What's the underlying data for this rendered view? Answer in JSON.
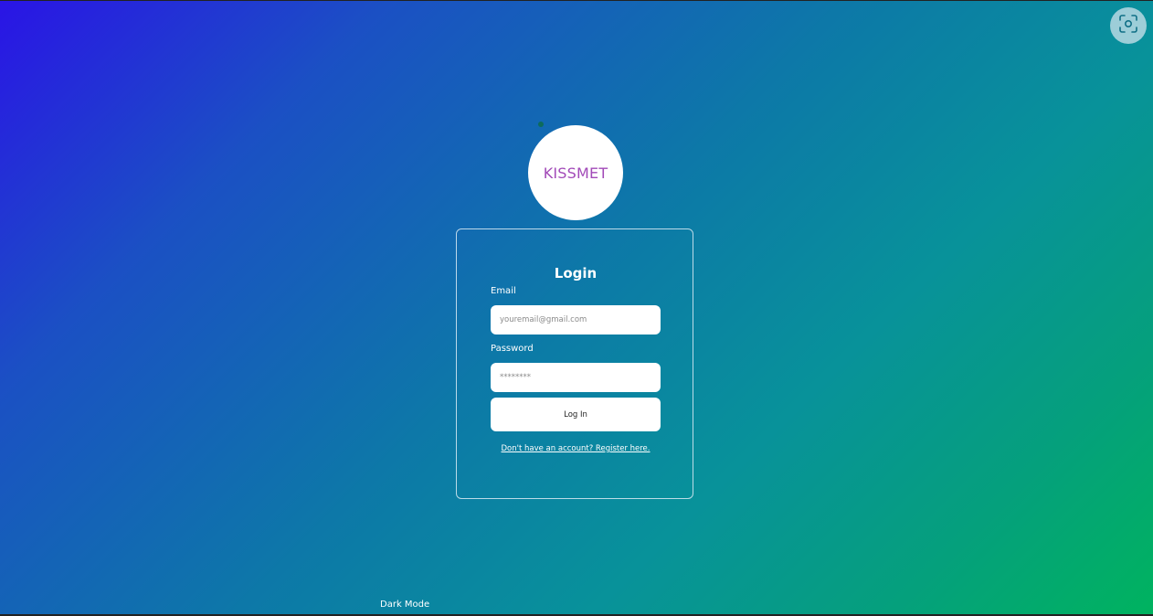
{
  "logo": {
    "text": "KISSMET",
    "text_color": "#a24ab8",
    "mark_color": "#0d6b5b"
  },
  "login_form": {
    "title": "Login",
    "email_label": "Email",
    "email_placeholder": "youremail@gmail.com",
    "password_label": "Password",
    "password_placeholder": "********",
    "submit_label": "Log In",
    "register_link": "Don't have an account? Register here."
  },
  "footer": {
    "dark_mode_label": "Dark Mode"
  },
  "icons": {
    "screen_capture": "screen-capture-icon"
  },
  "colors": {
    "gradient_start": "#2a14e6",
    "gradient_end": "#00b35f",
    "card_border": "#dcebf5"
  }
}
